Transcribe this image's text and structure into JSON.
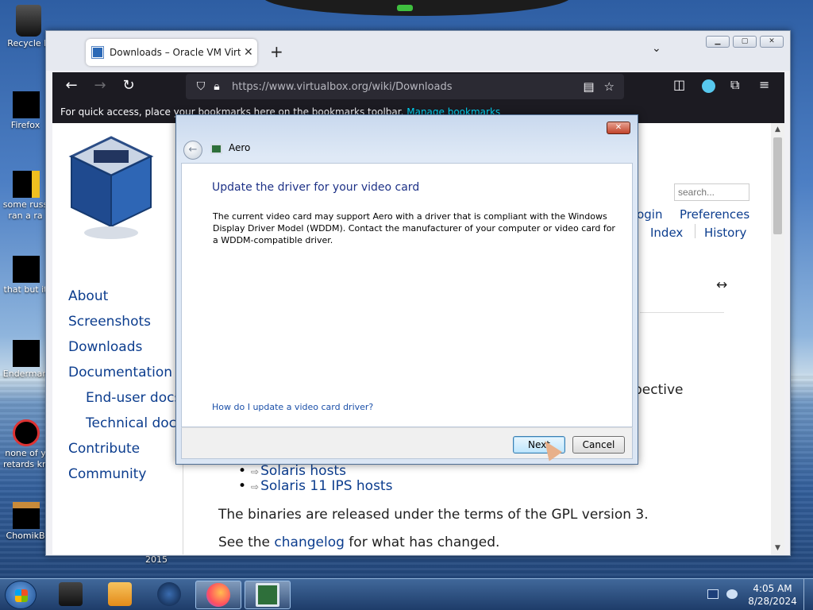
{
  "desktop": {
    "icons": [
      {
        "label": "Recycle B",
        "label2": ""
      },
      {
        "label": "Firefox",
        "label2": ""
      },
      {
        "label": "some russ",
        "label2": "ran a ra"
      },
      {
        "label": "that but it",
        "label2": ""
      },
      {
        "label": "Enderman",
        "label2": ""
      },
      {
        "label": "none of y",
        "label2": "retards kn"
      },
      {
        "label": "ChomikB",
        "label2": ""
      }
    ],
    "year_label": "2015"
  },
  "browser": {
    "tab_title": "Downloads – Oracle VM VirtualBox",
    "tab_close": "✕",
    "new_tab": "+",
    "tabs_menu": "⌄",
    "url": "https://www.virtualbox.org/wiki/Downloads",
    "bookmarks_text": "For quick access, place your bookmarks here on the bookmarks toolbar.",
    "bookmarks_link": "Manage bookmarks"
  },
  "page": {
    "sidebar": {
      "items": [
        "About",
        "Screenshots",
        "Downloads",
        "Documentation",
        "End-user docs",
        "Technical docs",
        "Contribute",
        "Community"
      ]
    },
    "search_placeholder": "search...",
    "nav": {
      "login": "Login",
      "preferences": "Preferences",
      "index": "Index",
      "history": "History"
    },
    "fragment": "pective",
    "list": [
      "Solaris hosts",
      "Solaris 11 IPS hosts"
    ],
    "gpl_text": "The binaries are released under the terms of the GPL version 3.",
    "changelog_pre": "See the ",
    "changelog_link": "changelog",
    "changelog_post": " for what has changed."
  },
  "dialog": {
    "app_title": "Aero",
    "heading": "Update the driver for your video card",
    "description": "The current video card may support Aero with a driver that is compliant with the Windows Display Driver Model (WDDM).  Contact the manufacturer of your computer or video card for a WDDM-compatible driver.",
    "help_link": "How do I update a video card driver?",
    "next_label": "Next",
    "cancel_label": "Cancel",
    "close_label": "✕"
  },
  "taskbar": {
    "time": "4:05 AM",
    "date": "8/28/2024"
  },
  "colors": {
    "link": "#0c3d8e",
    "dialog_heading": "#1e3287",
    "firefox_toolbar": "#1c1b22"
  }
}
